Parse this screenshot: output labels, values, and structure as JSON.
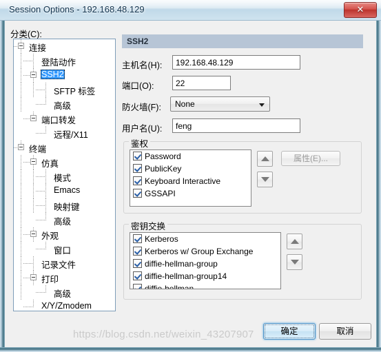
{
  "window": {
    "title": "Session Options - 192.168.48.129",
    "close_label": "✕"
  },
  "sidebar": {
    "label": "分类(C):",
    "items": [
      {
        "label": "连接",
        "indent": 0,
        "expander": true,
        "selected": false
      },
      {
        "label": "登陆动作",
        "indent": 1,
        "expander": false,
        "selected": false
      },
      {
        "label": "SSH2",
        "indent": 1,
        "expander": true,
        "selected": true
      },
      {
        "label": "SFTP 标签",
        "indent": 2,
        "expander": false,
        "selected": false
      },
      {
        "label": "高级",
        "indent": 2,
        "expander": false,
        "selected": false
      },
      {
        "label": "端口转发",
        "indent": 1,
        "expander": true,
        "selected": false
      },
      {
        "label": "远程/X11",
        "indent": 2,
        "expander": false,
        "selected": false
      },
      {
        "label": "终端",
        "indent": 0,
        "expander": true,
        "selected": false
      },
      {
        "label": "仿真",
        "indent": 1,
        "expander": true,
        "selected": false
      },
      {
        "label": "模式",
        "indent": 2,
        "expander": false,
        "selected": false
      },
      {
        "label": "Emacs",
        "indent": 2,
        "expander": false,
        "selected": false
      },
      {
        "label": "映射键",
        "indent": 2,
        "expander": false,
        "selected": false
      },
      {
        "label": "高级",
        "indent": 2,
        "expander": false,
        "selected": false
      },
      {
        "label": "外观",
        "indent": 1,
        "expander": true,
        "selected": false
      },
      {
        "label": "窗口",
        "indent": 2,
        "expander": false,
        "selected": false
      },
      {
        "label": "记录文件",
        "indent": 1,
        "expander": false,
        "selected": false
      },
      {
        "label": "打印",
        "indent": 1,
        "expander": true,
        "selected": false
      },
      {
        "label": "高级",
        "indent": 2,
        "expander": false,
        "selected": false
      },
      {
        "label": "X/Y/Zmodem",
        "indent": 1,
        "expander": false,
        "selected": false
      }
    ]
  },
  "pane": {
    "header": "SSH2",
    "fields": {
      "hostname_label": "主机名(H):",
      "hostname_value": "192.168.48.129",
      "port_label": "端口(O):",
      "port_value": "22",
      "firewall_label": "防火墙(F):",
      "firewall_value": "None",
      "username_label": "用户名(U):",
      "username_value": "feng"
    },
    "auth_group": {
      "title": "鉴权",
      "items": [
        {
          "label": "Password",
          "checked": true
        },
        {
          "label": "PublicKey",
          "checked": true
        },
        {
          "label": "Keyboard Interactive",
          "checked": true
        },
        {
          "label": "GSSAPI",
          "checked": true
        }
      ],
      "move_up_icon": "triangle-up-icon",
      "move_down_icon": "triangle-down-icon",
      "properties_label": "属性(E)..."
    },
    "kex_group": {
      "title": "密钥交换",
      "items": [
        {
          "label": "Kerberos",
          "checked": true
        },
        {
          "label": "Kerberos w/ Group Exchange",
          "checked": true
        },
        {
          "label": "diffie-hellman-group",
          "checked": true
        },
        {
          "label": "diffie-hellman-group14",
          "checked": true
        },
        {
          "label": "diffie-hellman",
          "checked": true
        }
      ],
      "move_up_icon": "triangle-up-icon",
      "move_down_icon": "triangle-down-icon"
    }
  },
  "footer": {
    "ok_label": "确定",
    "cancel_label": "取消"
  },
  "watermark": "https://blog.csdn.net/weixin_43207907",
  "colors": {
    "selection": "#3399ff",
    "pane_header": "#b7c5d6",
    "dialog_bg": "#f0f0f0",
    "close_button": "#c9403a"
  }
}
